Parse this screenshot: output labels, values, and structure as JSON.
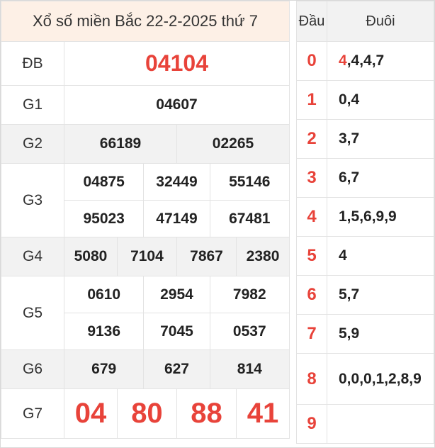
{
  "title": "Xổ số miền Bắc 22-2-2025 thứ 7",
  "prizes": {
    "db": {
      "label": "ĐB",
      "numbers": [
        "04104"
      ]
    },
    "g1": {
      "label": "G1",
      "numbers": [
        "04607"
      ]
    },
    "g2": {
      "label": "G2",
      "numbers": [
        "66189",
        "02265"
      ]
    },
    "g3": {
      "label": "G3",
      "numbers": [
        "04875",
        "32449",
        "55146",
        "95023",
        "47149",
        "67481"
      ]
    },
    "g4": {
      "label": "G4",
      "numbers": [
        "5080",
        "7104",
        "7867",
        "2380"
      ]
    },
    "g5": {
      "label": "G5",
      "numbers": [
        "0610",
        "2954",
        "7982",
        "9136",
        "7045",
        "0537"
      ]
    },
    "g6": {
      "label": "G6",
      "numbers": [
        "679",
        "627",
        "814"
      ]
    },
    "g7": {
      "label": "G7",
      "numbers": [
        "04",
        "80",
        "88",
        "41"
      ]
    }
  },
  "loto": {
    "head_label": "Đầu",
    "tail_label": "Đuôi",
    "rows": [
      {
        "dau": "0",
        "duoi_first": "4",
        "duoi_rest": ",4,4,7"
      },
      {
        "dau": "1",
        "duoi_first": "",
        "duoi_rest": "0,4"
      },
      {
        "dau": "2",
        "duoi_first": "",
        "duoi_rest": "3,7"
      },
      {
        "dau": "3",
        "duoi_first": "",
        "duoi_rest": "6,7"
      },
      {
        "dau": "4",
        "duoi_first": "",
        "duoi_rest": "1,5,6,9,9"
      },
      {
        "dau": "5",
        "duoi_first": "",
        "duoi_rest": "4"
      },
      {
        "dau": "6",
        "duoi_first": "",
        "duoi_rest": "5,7"
      },
      {
        "dau": "7",
        "duoi_first": "",
        "duoi_rest": "5,9"
      },
      {
        "dau": "8",
        "duoi_first": "",
        "duoi_rest": "0,0,0,1,2,8,9"
      },
      {
        "dau": "9",
        "duoi_first": "",
        "duoi_rest": ""
      }
    ]
  },
  "colors": {
    "accent_red": "#e8433a",
    "title_bg": "#fdf0e6",
    "shade_bg": "#f2f2f2"
  }
}
